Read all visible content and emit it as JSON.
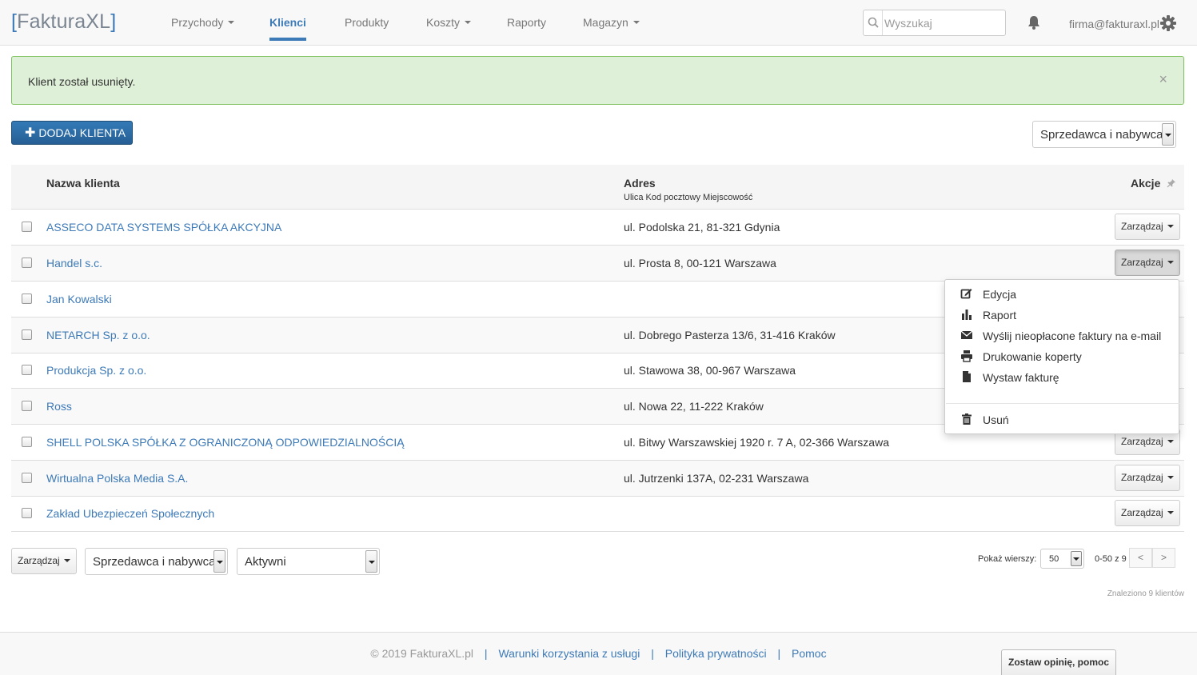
{
  "app": {
    "logo_bracket_open": "[",
    "logo_text": "FakturaXL",
    "logo_bracket_close": "]"
  },
  "nav": {
    "items": [
      {
        "label": "Przychody",
        "dropdown": true
      },
      {
        "label": "Klienci",
        "active": true
      },
      {
        "label": "Produkty"
      },
      {
        "label": "Koszty",
        "dropdown": true
      },
      {
        "label": "Raporty"
      },
      {
        "label": "Magazyn",
        "dropdown": true
      }
    ],
    "search_placeholder": "Wyszukaj",
    "user_email": "firma@fakturaxl.pl"
  },
  "alert": {
    "message": "Klient został usunięty.",
    "close": "×"
  },
  "toolbar": {
    "add_client": "DODAJ KLIENTA",
    "filter_type": "Sprzedawca i nabywca"
  },
  "table": {
    "headers": {
      "name": "Nazwa klienta",
      "address": "Adres",
      "address_sub": "Ulica Kod pocztowy Miejscowość",
      "actions": "Akcje"
    },
    "manage_label": "Zarządzaj",
    "rows": [
      {
        "name": "ASSECO DATA SYSTEMS SPÓŁKA AKCYJNA",
        "address": "ul. Podolska 21, 81-321 Gdynia"
      },
      {
        "name": "Handel s.c.",
        "address": "ul. Prosta 8, 00-121 Warszawa"
      },
      {
        "name": "Jan Kowalski",
        "address": ""
      },
      {
        "name": "NETARCH Sp. z o.o.",
        "address": "ul. Dobrego Pasterza 13/6, 31-416 Kraków"
      },
      {
        "name": "Produkcja Sp. z o.o.",
        "address": "ul. Stawowa 38, 00-967 Warszawa"
      },
      {
        "name": "Ross",
        "address": "ul. Nowa 22, 11-222 Kraków"
      },
      {
        "name": "SHELL POLSKA SPÓŁKA Z OGRANICZONĄ ODPOWIEDZIALNOŚCIĄ",
        "address": "ul. Bitwy Warszawskiej 1920 r. 7 A, 02-366 Warszawa"
      },
      {
        "name": "Wirtualna Polska Media S.A.",
        "address": "ul. Jutrzenki 137A, 02-231 Warszawa"
      },
      {
        "name": "Zakład Ubezpieczeń Społecznych",
        "address": ""
      }
    ]
  },
  "dropdown": {
    "items": [
      {
        "label": "Edycja",
        "icon": "edit-icon"
      },
      {
        "label": "Raport",
        "icon": "bar-chart-icon"
      },
      {
        "label": "Wyślij nieopłacone faktury na e-mail",
        "icon": "envelope-icon"
      },
      {
        "label": "Drukowanie koperty",
        "icon": "printer-icon"
      },
      {
        "label": "Wystaw fakturę",
        "icon": "document-icon"
      }
    ],
    "delete": {
      "label": "Usuń",
      "icon": "trash-icon"
    }
  },
  "bottom": {
    "manage": "Zarządzaj",
    "filter_type": "Sprzedawca i nabywca",
    "filter_status": "Aktywni",
    "rows_label": "Pokaż wierszy:",
    "rows_value": "50",
    "page_info": "0-50 z 9",
    "prev": "<",
    "next": ">",
    "found": "Znaleziono 9 klientów"
  },
  "footer": {
    "copyright": "© 2019 FakturaXL.pl",
    "terms": "Warunki korzystania z usługi",
    "privacy": "Polityka prywatności",
    "help": "Pomoc",
    "separator": "|",
    "feedback": "Zostaw opinię, pomoc"
  }
}
